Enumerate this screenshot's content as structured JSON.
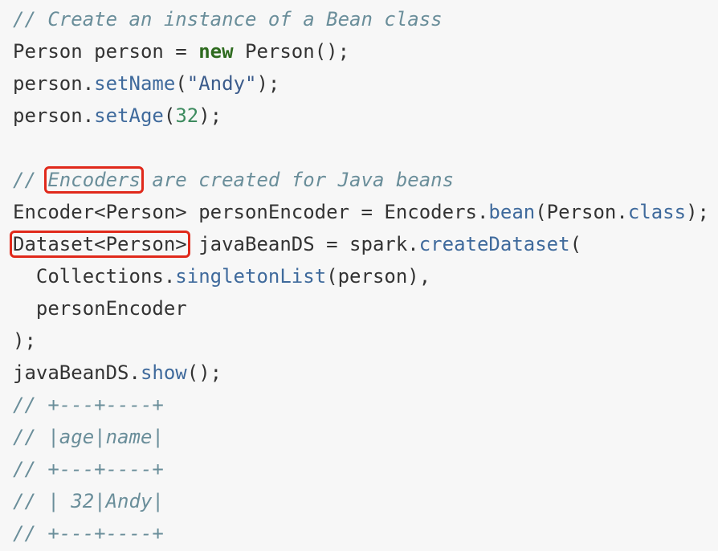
{
  "colors": {
    "background": "#f7f7f7",
    "text": "#333333",
    "comment": "#6a8e9a",
    "keyword": "#2e6b1f",
    "method": "#3f6a9c",
    "string": "#3c5c8c",
    "number": "#3d8b5f",
    "highlight_box": "#e0291b"
  },
  "code": {
    "l1": {
      "comment": "// Create an instance of a Bean class"
    },
    "l2": {
      "a": "Person person = ",
      "kw": "new",
      "b": " Person();"
    },
    "l3": {
      "a": "person.",
      "method": "setName",
      "b": "(",
      "str": "\"Andy\"",
      "c": ");"
    },
    "l4": {
      "a": "person.",
      "method": "setAge",
      "b": "(",
      "num": "32",
      "c": ");"
    },
    "l6": {
      "prefix": "// ",
      "highlight": "Encoders",
      "rest": " are created for Java beans"
    },
    "l7": {
      "a": "Encoder<Person> personEncoder = Encoders.",
      "method": "bean",
      "b": "(Person.",
      "method2": "class",
      "c": ");"
    },
    "l8": {
      "highlight": "Dataset<Person>",
      "a": " javaBeanDS = spark.",
      "method": "createDataset",
      "b": "("
    },
    "l9": {
      "a": "  Collections.",
      "method": "singletonList",
      "b": "(person),"
    },
    "l10": {
      "a": "  personEncoder"
    },
    "l11": {
      "a": ");"
    },
    "l12": {
      "a": "javaBeanDS.",
      "method": "show",
      "b": "();"
    },
    "l13": {
      "comment": "// +---+----+"
    },
    "l14": {
      "comment": "// |age|name|"
    },
    "l15": {
      "comment": "// +---+----+"
    },
    "l16": {
      "comment": "// | 32|Andy|"
    },
    "l17": {
      "comment": "// +---+----+"
    }
  }
}
